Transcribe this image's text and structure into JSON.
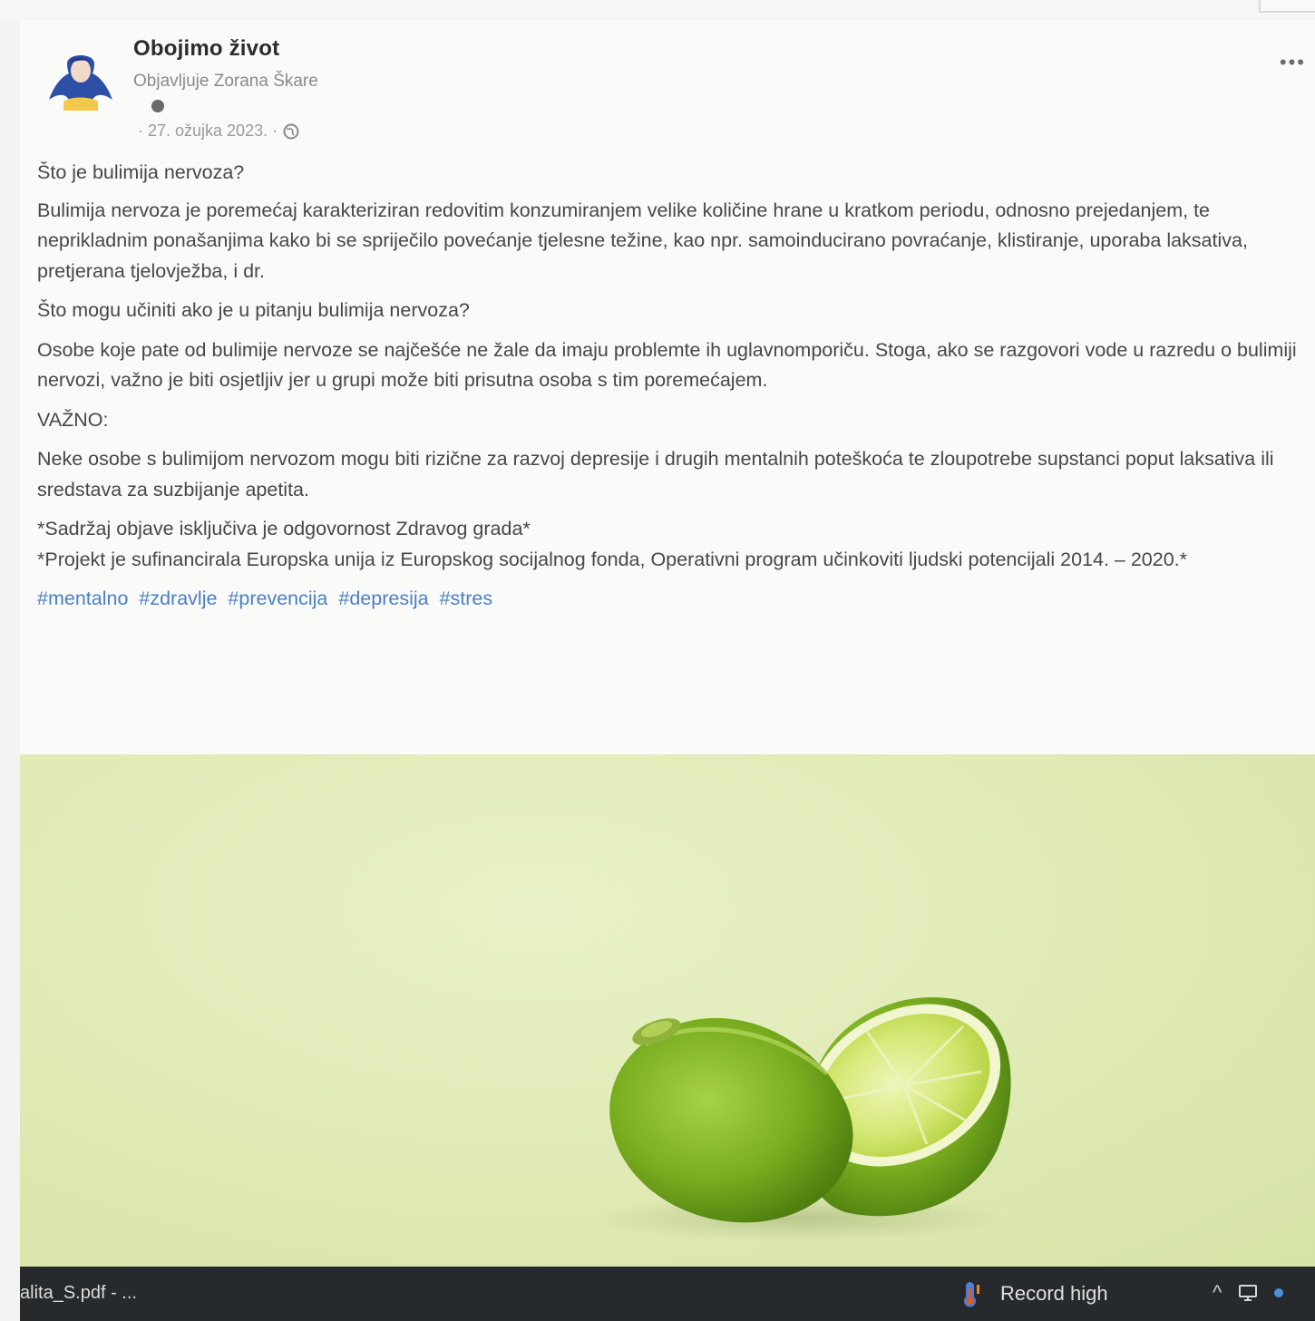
{
  "post": {
    "page_name": "Obojimo život",
    "publisher": "Objavljuje Zorana Škare",
    "date": "· 27. ožujka 2023. ·",
    "more_label": "•••",
    "heading1": "Što je bulimija nervoza?",
    "paragraph1": "Bulimija nervoza je poremećaj karakteriziran redovitim konzumiranjem velike količine hrane u kratkom periodu, odnosno prejedanjem, te neprikladnim ponašanjima kako bi se spriječilo povećanje tjelesne težine, kao npr. samoinducirano povraćanje, klistiranje, uporaba laksativa, pretjerana tjelovježba, i dr.",
    "heading2": "Što mogu učiniti ako je u pitanju bulimija nervoza?",
    "paragraph2": "Osobe koje pate od bulimije nervoze se najčešće ne žale da imaju problemte ih uglavnomporiču. Stoga, ako se razgovori vode u razredu o bulimiji nervozi, važno je biti osjetljiv jer u grupi može biti prisutna osoba s tim poremećajem.",
    "important": "VAŽNO:",
    "paragraph3": "Neke osobe s bulimijom nervozom mogu biti rizične za razvoj depresije i drugih mentalnih poteškoća te zloupotrebe supstanci poput laksativa ili sredstava za suzbijanje apetita.",
    "disclaimer1": "*Sadržaj objave isključiva je odgovornost Zdravog grada*",
    "disclaimer2": "*Projekt je sufinancirala Europska unija iz Europskog socijalnog fonda, Operativni program učinkoviti ljudski potencijali 2014. – 2020.*",
    "hashtags": [
      "#mentalno",
      "#zdravlje",
      "#prevencija",
      "#depresija",
      "#stres"
    ]
  },
  "taskbar": {
    "file_label": "alita_S.pdf - ...",
    "weather_label": "Record high",
    "chevron": "^"
  },
  "colors": {
    "accent_link": "#4a7fc4",
    "taskbar_bg": "#262a2c",
    "photo_bg": "#e1ebb8"
  }
}
